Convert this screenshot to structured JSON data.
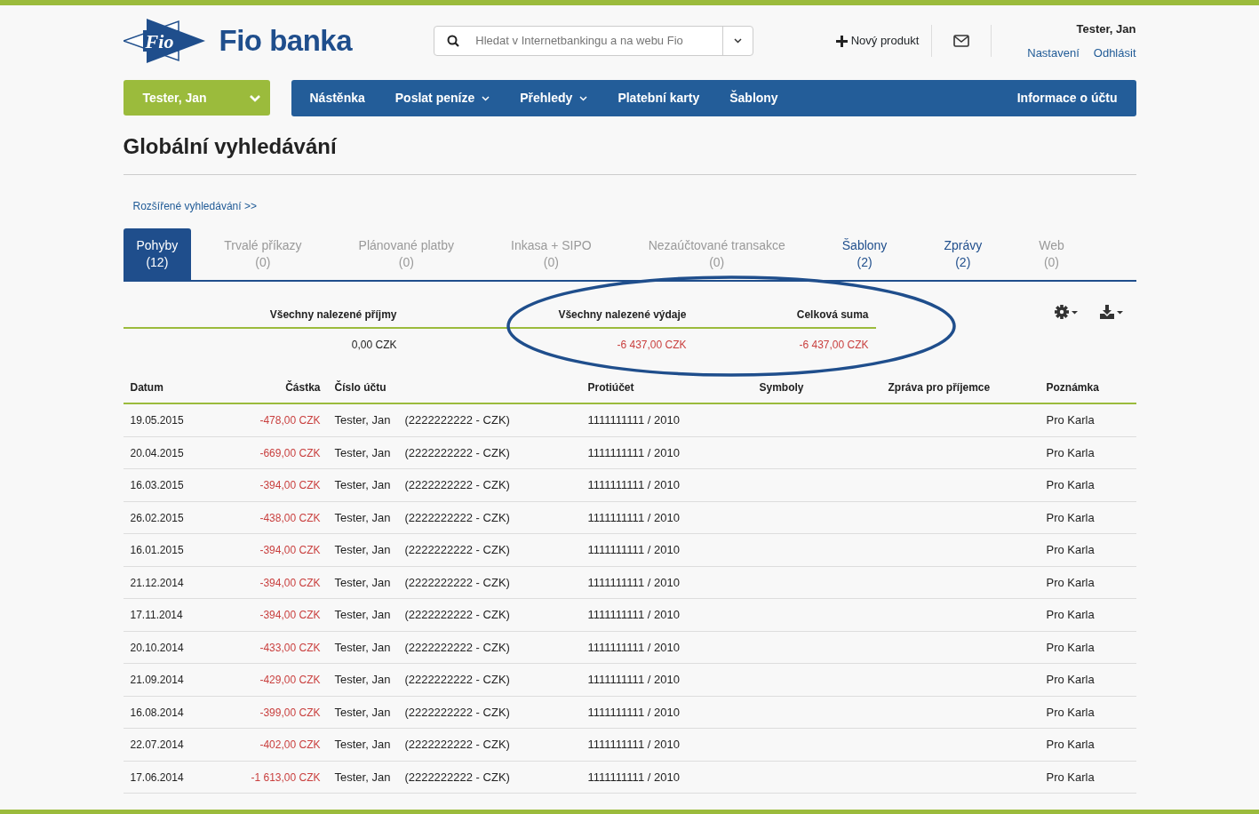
{
  "header": {
    "logo_text": "Fio banka",
    "logo_mark": "Fio",
    "search": {
      "placeholder": "Hledat v Internetbankingu a na webu Fio"
    },
    "new_product": "Nový produkt",
    "user_name": "Tester, Jan",
    "links": [
      "Nastavení",
      "Odhlásit"
    ]
  },
  "account_selector": "Tester, Jan",
  "nav": [
    {
      "label": "Nástěnka",
      "dropdown": false
    },
    {
      "label": "Poslat peníze",
      "dropdown": true
    },
    {
      "label": "Přehledy",
      "dropdown": true
    },
    {
      "label": "Platební karty",
      "dropdown": false
    },
    {
      "label": "Šablony",
      "dropdown": false
    }
  ],
  "nav_right": "Informace o účtu",
  "page_title": "Globální vyhledávání",
  "advanced_link": "Rozšířené vyhledávání >>",
  "tabs": [
    {
      "label": "Pohyby",
      "count": "(12)",
      "selected": true,
      "disabled": false
    },
    {
      "label": "Trvalé příkazy",
      "count": "(0)",
      "selected": false,
      "disabled": true
    },
    {
      "label": "Plánované platby",
      "count": "(0)",
      "selected": false,
      "disabled": true
    },
    {
      "label": "Inkasa + SIPO",
      "count": "(0)",
      "selected": false,
      "disabled": true
    },
    {
      "label": "Nezaúčtované transakce",
      "count": "(0)",
      "selected": false,
      "disabled": true
    },
    {
      "label": "Šablony",
      "count": "(2)",
      "selected": false,
      "disabled": false
    },
    {
      "label": "Zprávy",
      "count": "(2)",
      "selected": false,
      "disabled": false
    },
    {
      "label": "Web",
      "count": "(0)",
      "selected": false,
      "disabled": true
    }
  ],
  "summary": [
    {
      "label": "Všechny nalezené příjmy",
      "value": "0,00 CZK",
      "negative": false
    },
    {
      "label": "Všechny nalezené výdaje",
      "value": "-6 437,00 CZK",
      "negative": true
    },
    {
      "label": "Celková suma",
      "value": "-6 437,00 CZK",
      "negative": true
    }
  ],
  "table": {
    "columns": [
      "Datum",
      "Částka",
      "Číslo účtu",
      "Protiúčet",
      "Symboly",
      "Zpráva pro příjemce",
      "Poznámka"
    ],
    "rows": [
      {
        "date": "19.05.2015",
        "amount": "-478,00 CZK",
        "name": "Tester, Jan",
        "account": "(2222222222 - CZK)",
        "counter": "1111111111 / 2010",
        "note": "Pro Karla"
      },
      {
        "date": "20.04.2015",
        "amount": "-669,00 CZK",
        "name": "Tester, Jan",
        "account": "(2222222222 - CZK)",
        "counter": "1111111111 / 2010",
        "note": "Pro Karla"
      },
      {
        "date": "16.03.2015",
        "amount": "-394,00 CZK",
        "name": "Tester, Jan",
        "account": "(2222222222 - CZK)",
        "counter": "1111111111 / 2010",
        "note": "Pro Karla"
      },
      {
        "date": "26.02.2015",
        "amount": "-438,00 CZK",
        "name": "Tester, Jan",
        "account": "(2222222222 - CZK)",
        "counter": "1111111111 / 2010",
        "note": "Pro Karla"
      },
      {
        "date": "16.01.2015",
        "amount": "-394,00 CZK",
        "name": "Tester, Jan",
        "account": "(2222222222 - CZK)",
        "counter": "1111111111 / 2010",
        "note": "Pro Karla"
      },
      {
        "date": "21.12.2014",
        "amount": "-394,00 CZK",
        "name": "Tester, Jan",
        "account": "(2222222222 - CZK)",
        "counter": "1111111111 / 2010",
        "note": "Pro Karla"
      },
      {
        "date": "17.11.2014",
        "amount": "-394,00 CZK",
        "name": "Tester, Jan",
        "account": "(2222222222 - CZK)",
        "counter": "1111111111 / 2010",
        "note": "Pro Karla"
      },
      {
        "date": "20.10.2014",
        "amount": "-433,00 CZK",
        "name": "Tester, Jan",
        "account": "(2222222222 - CZK)",
        "counter": "1111111111 / 2010",
        "note": "Pro Karla"
      },
      {
        "date": "21.09.2014",
        "amount": "-429,00 CZK",
        "name": "Tester, Jan",
        "account": "(2222222222 - CZK)",
        "counter": "1111111111 / 2010",
        "note": "Pro Karla"
      },
      {
        "date": "16.08.2014",
        "amount": "-399,00 CZK",
        "name": "Tester, Jan",
        "account": "(2222222222 - CZK)",
        "counter": "1111111111 / 2010",
        "note": "Pro Karla"
      },
      {
        "date": "22.07.2014",
        "amount": "-402,00 CZK",
        "name": "Tester, Jan",
        "account": "(2222222222 - CZK)",
        "counter": "1111111111 / 2010",
        "note": "Pro Karla"
      },
      {
        "date": "17.06.2014",
        "amount": "-1 613,00 CZK",
        "name": "Tester, Jan",
        "account": "(2222222222 - CZK)",
        "counter": "1111111111 / 2010",
        "note": "Pro Karla"
      }
    ]
  }
}
